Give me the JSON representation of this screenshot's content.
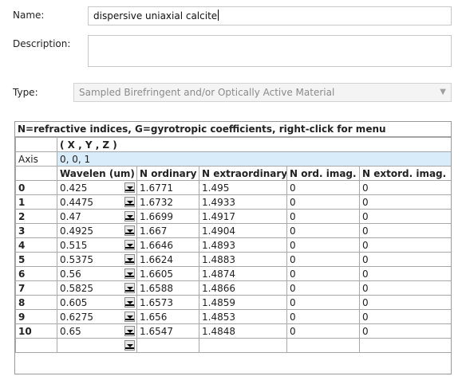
{
  "form": {
    "name_label": "Name:",
    "name_value": "dispersive uniaxial calcite",
    "description_label": "Description:",
    "description_value": "",
    "type_label": "Type:",
    "type_value": "Sampled Birefringent and/or Optically Active Material"
  },
  "grid": {
    "title": "N=refractive indices,  G=gyrotropic coefficients,  right-click for menu",
    "axis_header": "( X , Y , Z )",
    "axis_label": "Axis",
    "axis_value": "0,  0,  1",
    "columns": [
      "Wavelen (um)",
      "N ordinary",
      "N extraordinary",
      "N ord. imag.",
      "N extord. imag."
    ],
    "rows": [
      {
        "index": "0",
        "wavelen": "0.425",
        "n_ord": "1.6771",
        "n_ext": "1.495",
        "n_ord_imag": "0",
        "n_ext_imag": "0"
      },
      {
        "index": "1",
        "wavelen": "0.4475",
        "n_ord": "1.6732",
        "n_ext": "1.4933",
        "n_ord_imag": "0",
        "n_ext_imag": "0"
      },
      {
        "index": "2",
        "wavelen": "0.47",
        "n_ord": "1.6699",
        "n_ext": "1.4917",
        "n_ord_imag": "0",
        "n_ext_imag": "0"
      },
      {
        "index": "3",
        "wavelen": "0.4925",
        "n_ord": "1.667",
        "n_ext": "1.4904",
        "n_ord_imag": "0",
        "n_ext_imag": "0"
      },
      {
        "index": "4",
        "wavelen": "0.515",
        "n_ord": "1.6646",
        "n_ext": "1.4893",
        "n_ord_imag": "0",
        "n_ext_imag": "0"
      },
      {
        "index": "5",
        "wavelen": "0.5375",
        "n_ord": "1.6624",
        "n_ext": "1.4883",
        "n_ord_imag": "0",
        "n_ext_imag": "0"
      },
      {
        "index": "6",
        "wavelen": "0.56",
        "n_ord": "1.6605",
        "n_ext": "1.4874",
        "n_ord_imag": "0",
        "n_ext_imag": "0"
      },
      {
        "index": "7",
        "wavelen": "0.5825",
        "n_ord": "1.6588",
        "n_ext": "1.4866",
        "n_ord_imag": "0",
        "n_ext_imag": "0"
      },
      {
        "index": "8",
        "wavelen": "0.605",
        "n_ord": "1.6573",
        "n_ext": "1.4859",
        "n_ord_imag": "0",
        "n_ext_imag": "0"
      },
      {
        "index": "9",
        "wavelen": "0.6275",
        "n_ord": "1.656",
        "n_ext": "1.4853",
        "n_ord_imag": "0",
        "n_ext_imag": "0"
      },
      {
        "index": "10",
        "wavelen": "0.65",
        "n_ord": "1.6547",
        "n_ext": "1.4848",
        "n_ord_imag": "0",
        "n_ext_imag": "0"
      },
      {
        "index": "",
        "wavelen": "",
        "n_ord": "",
        "n_ext": "",
        "n_ord_imag": "",
        "n_ext_imag": ""
      }
    ]
  },
  "icons": {
    "select_arrow": "chevron-down-icon",
    "cell_dropdown": "dropdown-arrow-icon"
  },
  "colors": {
    "axis_highlight": "#d9ecfa",
    "grid_border": "#a8a8a8",
    "disabled_text": "#8a8a8a"
  }
}
